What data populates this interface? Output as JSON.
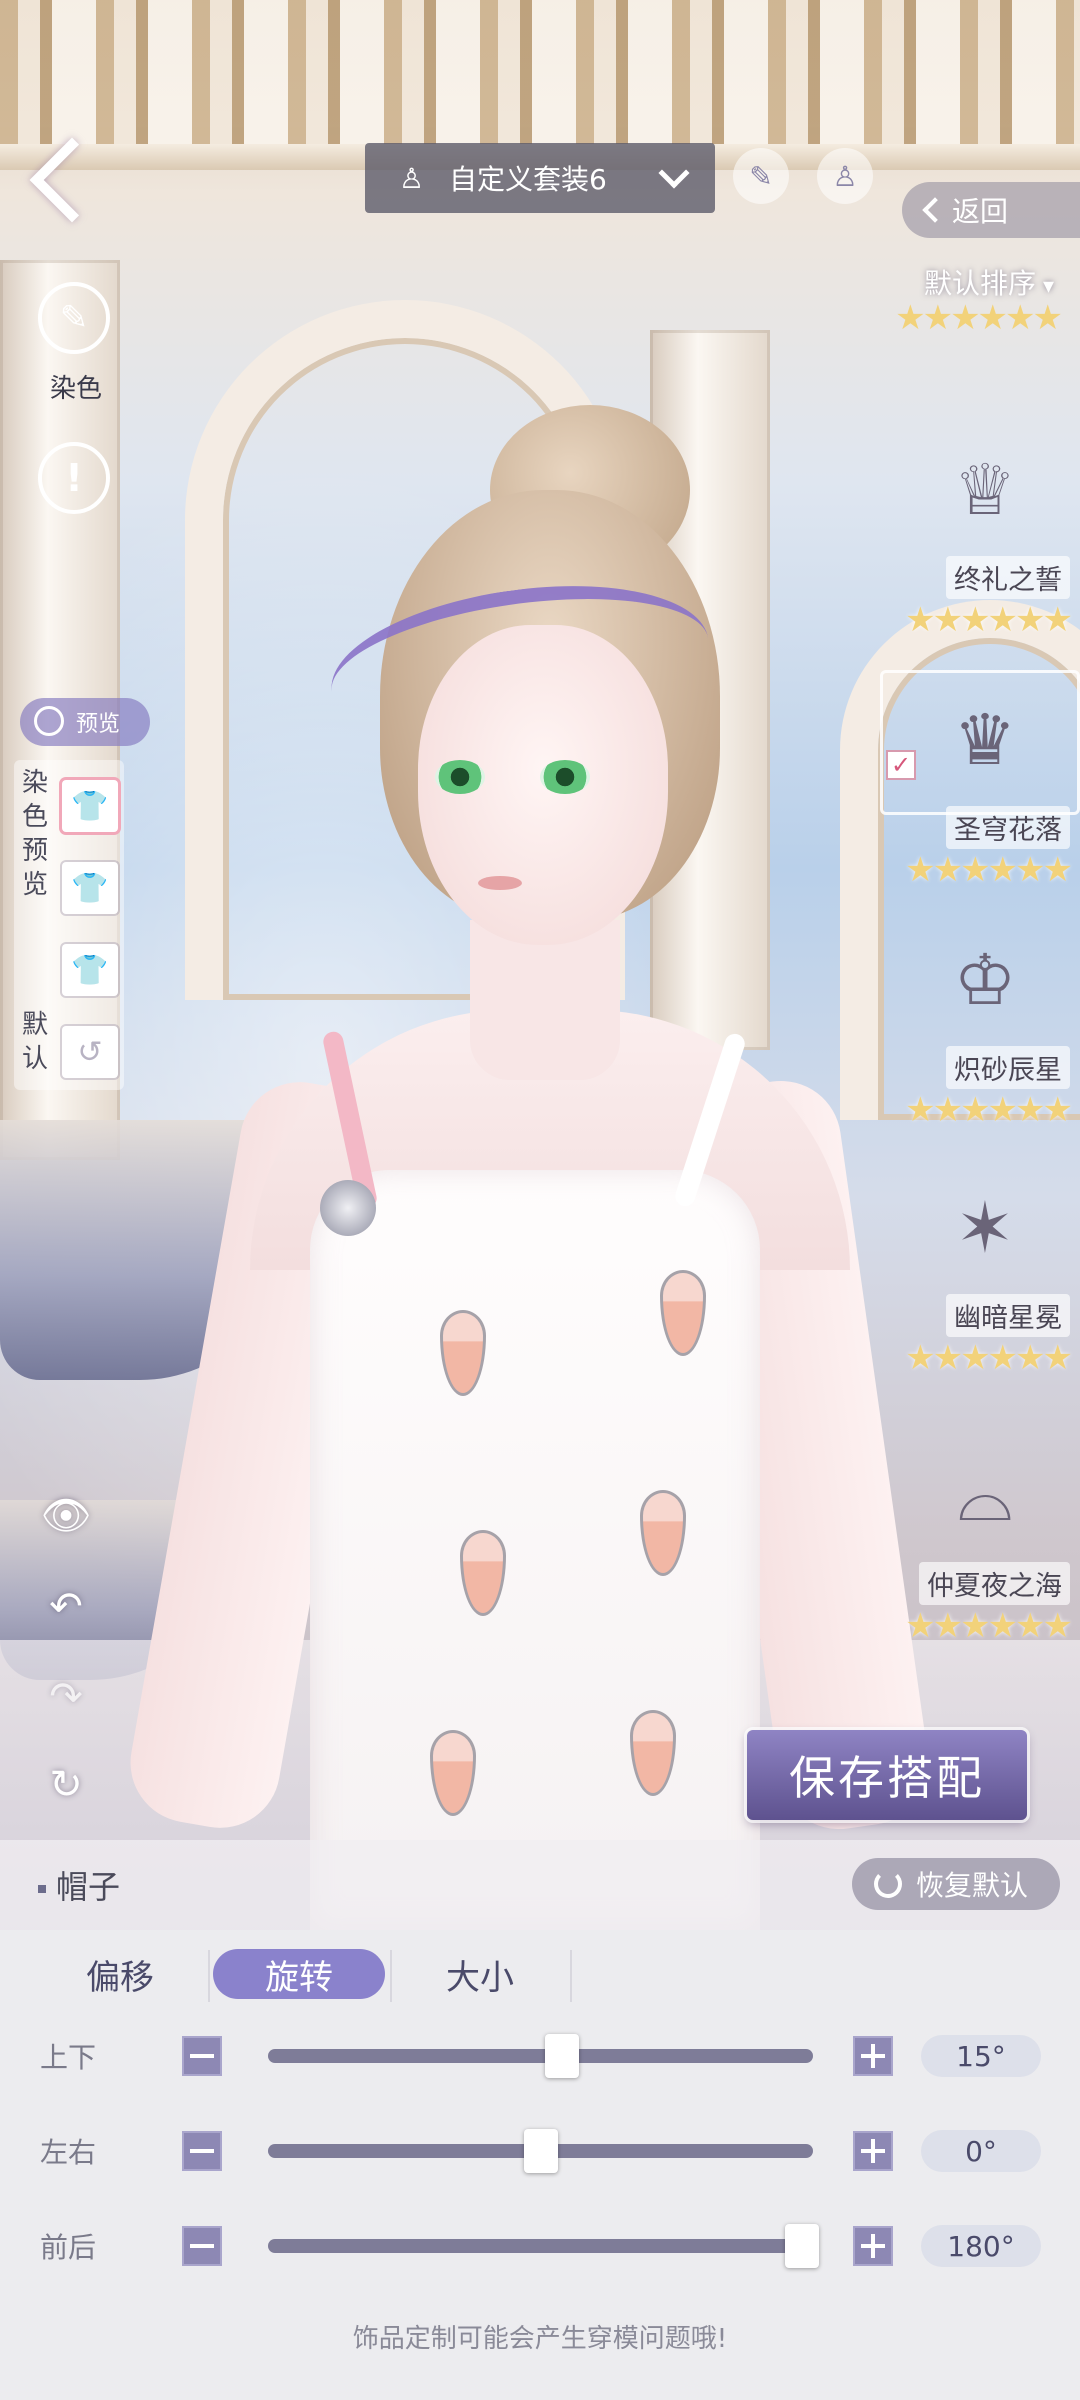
{
  "header": {
    "outfit_name": "自定义套装6",
    "return_label": "返回",
    "sort_label": "默认排序"
  },
  "left_toolbar": {
    "dye_label": "染色",
    "preview_label": "预览",
    "dye_preview_label": "染色预览",
    "default_label": "默认"
  },
  "accessories": [
    {
      "name": "终礼之誓",
      "stars": "★★★★★★",
      "icon": "chandelier-headpiece-icon"
    },
    {
      "name": "圣穹花落",
      "stars": "★★★★★★",
      "icon": "floral-tiara-icon",
      "selected": true
    },
    {
      "name": "炽砂辰星",
      "stars": "★★★★★★",
      "icon": "jeweled-cap-icon"
    },
    {
      "name": "幽暗星冕",
      "stars": "★★★★★★",
      "icon": "star-crown-icon"
    },
    {
      "name": "仲夏夜之海",
      "stars": "★★★★★★",
      "icon": "sunglasses-chain-icon"
    }
  ],
  "top_stars": "★★★★★★",
  "save_button": "保存搭配",
  "category": {
    "label": "帽子",
    "restore_label": "恢复默认"
  },
  "tabs": [
    {
      "label": "偏移",
      "active": false
    },
    {
      "label": "旋转",
      "active": true
    },
    {
      "label": "大小",
      "active": false
    }
  ],
  "sliders": [
    {
      "label": "上下",
      "value_text": "15°",
      "fraction": 0.54
    },
    {
      "label": "左右",
      "value_text": "0°",
      "fraction": 0.5
    },
    {
      "label": "前后",
      "value_text": "180°",
      "fraction": 0.98
    }
  ],
  "footnote": "饰品定制可能会产生穿模问题哦!",
  "colors": {
    "accent": "#8a82cc",
    "track": "#7e7c98",
    "stars": "#f2d27a"
  }
}
